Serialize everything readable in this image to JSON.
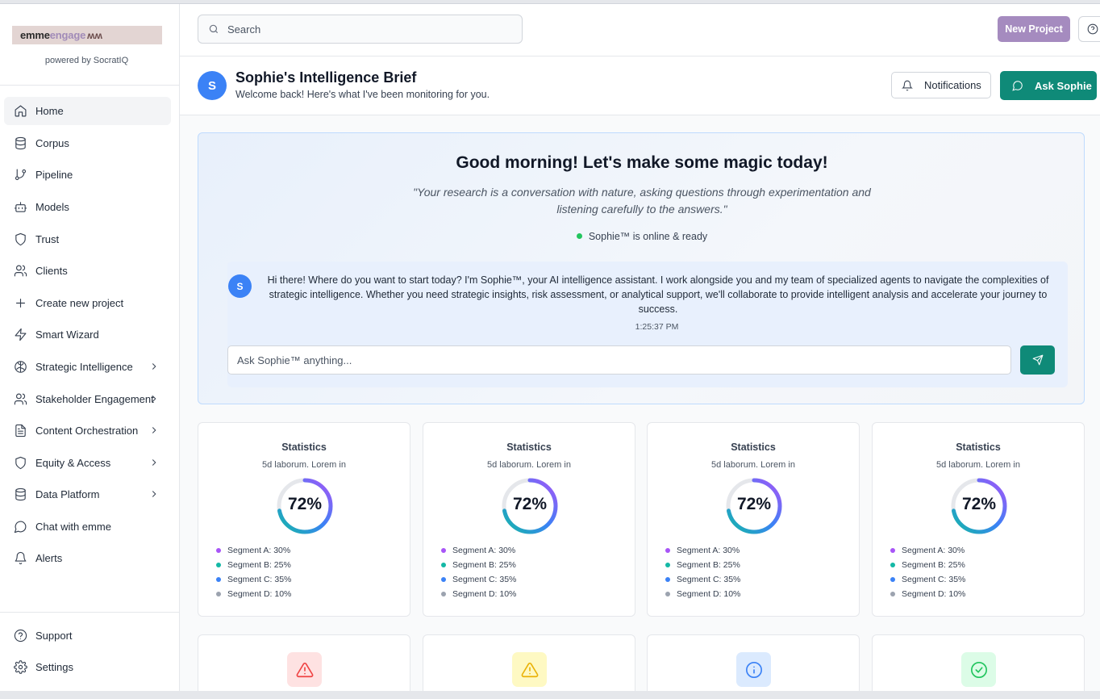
{
  "brand": {
    "logo_part1": "emme",
    "logo_part2": "engage",
    "logo_mark": "ʍʍ",
    "powered_by": "powered by SocratIQ"
  },
  "sidebar": {
    "items": [
      {
        "label": "Home",
        "icon": "home-icon",
        "active": true,
        "has_chevron": false
      },
      {
        "label": "Corpus",
        "icon": "database-icon",
        "has_chevron": false
      },
      {
        "label": "Pipeline",
        "icon": "git-branch-icon",
        "has_chevron": false
      },
      {
        "label": "Models",
        "icon": "bot-icon",
        "has_chevron": false
      },
      {
        "label": "Trust",
        "icon": "shield-icon",
        "has_chevron": false
      },
      {
        "label": "Clients",
        "icon": "users-icon",
        "has_chevron": false
      },
      {
        "label": "Create new project",
        "icon": "plus-icon",
        "has_chevron": false
      },
      {
        "label": "Smart Wizard",
        "icon": "zap-icon",
        "has_chevron": false
      },
      {
        "label": "Strategic Intelligence",
        "icon": "brain-icon",
        "has_chevron": true
      },
      {
        "label": "Stakeholder Engagement",
        "icon": "users-icon",
        "has_chevron": true
      },
      {
        "label": "Content Orchestration",
        "icon": "file-icon",
        "has_chevron": true
      },
      {
        "label": "Equity & Access",
        "icon": "shield-icon",
        "has_chevron": true
      },
      {
        "label": "Data Platform",
        "icon": "database-icon",
        "has_chevron": true
      },
      {
        "label": "Chat with emme",
        "icon": "chat-icon",
        "has_chevron": false
      },
      {
        "label": "Alerts",
        "icon": "bell-icon",
        "has_chevron": false
      }
    ],
    "footer": [
      {
        "label": "Support",
        "icon": "help-circle-icon"
      },
      {
        "label": "Settings",
        "icon": "gear-icon"
      }
    ]
  },
  "header": {
    "search_placeholder": "Search",
    "new_project_label": "New Project"
  },
  "brief": {
    "avatar_letter": "S",
    "title": "Sophie's Intelligence Brief",
    "subtitle": "Welcome back! Here's what I've been monitoring for you.",
    "notifications_label": "Notifications",
    "ask_label": "Ask Sophie"
  },
  "hero": {
    "greeting": "Good morning! Let's make some magic today!",
    "quote": "\"Your research is a conversation with nature, asking questions through experimentation and listening carefully to the answers.\"",
    "status": "Sophie™ is online & ready",
    "message_avatar": "S",
    "message": "Hi there! Where do you want to start today? I'm Sophie™, your AI intelligence assistant. I work alongside you and my team of specialized agents to navigate the complexities of strategic intelligence. Whether you need strategic insights, risk assessment, or analytical support, we'll collaborate to provide intelligent analysis and accelerate your journey to success.",
    "message_time": "1:25:37 PM",
    "input_placeholder": "Ask Sophie™ anything..."
  },
  "stats_cards": [
    {
      "title": "Statistics",
      "subtitle": "5d laborum. Lorem in",
      "value_text": "72%",
      "value": 72,
      "segments": [
        {
          "label": "Segment A: 30%",
          "color": "#a855f7"
        },
        {
          "label": "Segment B: 25%",
          "color": "#14b8a6"
        },
        {
          "label": "Segment C: 35%",
          "color": "#3b82f6"
        },
        {
          "label": "Segment D: 10%",
          "color": "#9ca3af"
        }
      ]
    },
    {
      "title": "Statistics",
      "subtitle": "5d laborum. Lorem in",
      "value_text": "72%",
      "value": 72,
      "segments": [
        {
          "label": "Segment A: 30%",
          "color": "#a855f7"
        },
        {
          "label": "Segment B: 25%",
          "color": "#14b8a6"
        },
        {
          "label": "Segment C: 35%",
          "color": "#3b82f6"
        },
        {
          "label": "Segment D: 10%",
          "color": "#9ca3af"
        }
      ]
    },
    {
      "title": "Statistics",
      "subtitle": "5d laborum. Lorem in",
      "value_text": "72%",
      "value": 72,
      "segments": [
        {
          "label": "Segment A: 30%",
          "color": "#a855f7"
        },
        {
          "label": "Segment B: 25%",
          "color": "#14b8a6"
        },
        {
          "label": "Segment C: 35%",
          "color": "#3b82f6"
        },
        {
          "label": "Segment D: 10%",
          "color": "#9ca3af"
        }
      ]
    },
    {
      "title": "Statistics",
      "subtitle": "5d laborum. Lorem in",
      "value_text": "72%",
      "value": 72,
      "segments": [
        {
          "label": "Segment A: 30%",
          "color": "#a855f7"
        },
        {
          "label": "Segment B: 25%",
          "color": "#14b8a6"
        },
        {
          "label": "Segment C: 35%",
          "color": "#3b82f6"
        },
        {
          "label": "Segment D: 10%",
          "color": "#9ca3af"
        }
      ]
    }
  ],
  "alert_cards": [
    {
      "icon": "alert-triangle-icon",
      "color": "#ef4444",
      "bg": "#fee2e2"
    },
    {
      "icon": "alert-triangle-icon",
      "color": "#eab308",
      "bg": "#fef9c3"
    },
    {
      "icon": "info-icon",
      "color": "#3b82f6",
      "bg": "#dbeafe"
    },
    {
      "icon": "check-circle-icon",
      "color": "#22c55e",
      "bg": "#dcfce7"
    }
  ],
  "colors": {
    "accent_teal": "#0f8a78",
    "new_project_purple": "#a58bbf",
    "avatar_blue": "#3b82f6",
    "online_green": "#22c55e"
  }
}
